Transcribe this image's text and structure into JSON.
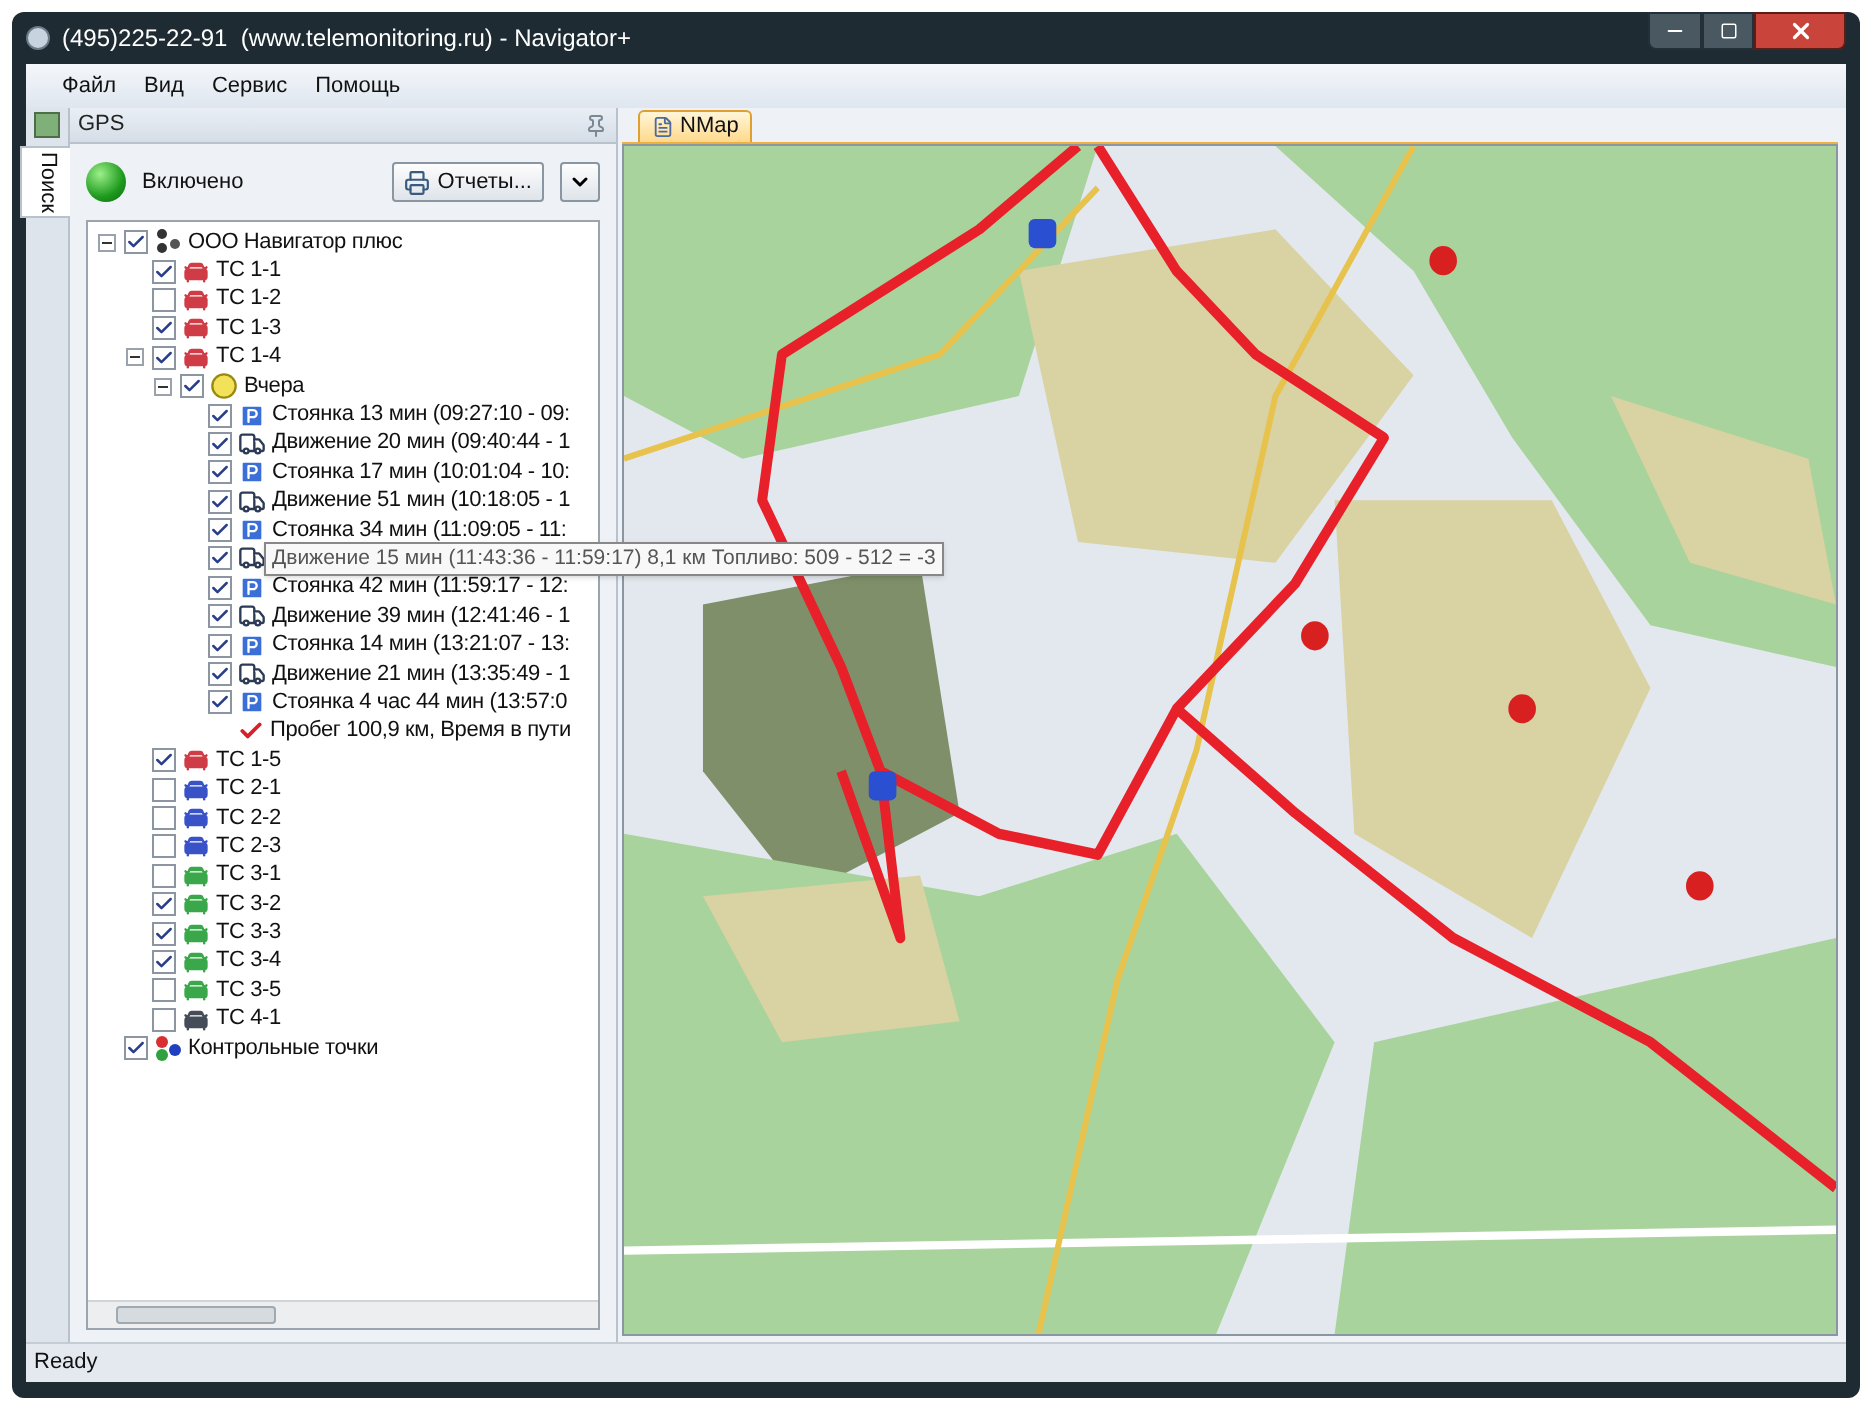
{
  "window": {
    "title": "(495)225-22-91  (www.telemonitoring.ru) - Navigator+"
  },
  "menu": [
    "Файл",
    "Вид",
    "Сервис",
    "Помощь"
  ],
  "side_tab": {
    "label": "Поиск"
  },
  "panel": {
    "title": "GPS",
    "status": {
      "label": "Включено",
      "on": true
    },
    "reports_button": "Отчеты..."
  },
  "tree": [
    {
      "kind": "company",
      "label": "ООО Навигатор плюс",
      "checked": true,
      "expanded": true,
      "children": [
        {
          "kind": "vehicle",
          "label": "ТС 1-1",
          "checked": true,
          "color": "#d03c46"
        },
        {
          "kind": "vehicle",
          "label": "ТС 1-2",
          "checked": false,
          "color": "#d03c46"
        },
        {
          "kind": "vehicle",
          "label": "ТС 1-3",
          "checked": true,
          "color": "#d03c46"
        },
        {
          "kind": "vehicle",
          "label": "ТС 1-4",
          "checked": true,
          "color": "#d03c46",
          "expanded": true,
          "children": [
            {
              "kind": "day",
              "label": "Вчера",
              "checked": true,
              "expanded": true,
              "children": [
                {
                  "kind": "parking",
                  "label": "Стоянка 13 мин (09:27:10 - 09:",
                  "checked": true
                },
                {
                  "kind": "movement",
                  "label": "Движение 20 мин (09:40:44 - 1",
                  "checked": true
                },
                {
                  "kind": "parking",
                  "label": "Стоянка 17 мин (10:01:04 - 10:",
                  "checked": true
                },
                {
                  "kind": "movement",
                  "label": "Движение 51 мин (10:18:05 - 1",
                  "checked": true
                },
                {
                  "kind": "parking",
                  "label": "Стоянка 34 мин (11:09:05 - 11:",
                  "checked": true
                },
                {
                  "kind": "movement",
                  "tooltip": "Движение 15 мин (11:43:36 - 11:59:17) 8,1 км  Топливо: 509 - 512 = -3",
                  "checked": true
                },
                {
                  "kind": "parking",
                  "label": "Стоянка 42 мин (11:59:17 - 12:",
                  "checked": true
                },
                {
                  "kind": "movement",
                  "label": "Движение 39 мин (12:41:46 - 1",
                  "checked": true
                },
                {
                  "kind": "parking",
                  "label": "Стоянка 14 мин (13:21:07 - 13:",
                  "checked": true
                },
                {
                  "kind": "movement",
                  "label": "Движение 21 мин (13:35:49 - 1",
                  "checked": true
                },
                {
                  "kind": "parking",
                  "label": "Стоянка 4 час 44 мин (13:57:0",
                  "checked": true
                },
                {
                  "kind": "summary",
                  "label": "Пробег 100,9 км, Время в пути"
                }
              ]
            }
          ]
        },
        {
          "kind": "vehicle",
          "label": "ТС 1-5",
          "checked": true,
          "color": "#d03c46"
        },
        {
          "kind": "vehicle",
          "label": "ТС 2-1",
          "checked": false,
          "color": "#3a52c8"
        },
        {
          "kind": "vehicle",
          "label": "ТС 2-2",
          "checked": false,
          "color": "#3a52c8"
        },
        {
          "kind": "vehicle",
          "label": "ТС 2-3",
          "checked": false,
          "color": "#3a52c8"
        },
        {
          "kind": "vehicle",
          "label": "ТС 3-1",
          "checked": false,
          "color": "#3aa84a"
        },
        {
          "kind": "vehicle",
          "label": "ТС 3-2",
          "checked": true,
          "color": "#3aa84a"
        },
        {
          "kind": "vehicle",
          "label": "ТС 3-3",
          "checked": true,
          "color": "#3aa84a"
        },
        {
          "kind": "vehicle",
          "label": "ТС 3-4",
          "checked": true,
          "color": "#3aa84a"
        },
        {
          "kind": "vehicle",
          "label": "ТС 3-5",
          "checked": false,
          "color": "#3aa84a"
        },
        {
          "kind": "vehicle",
          "label": "ТС 4-1",
          "checked": false,
          "color": "#454d58"
        }
      ]
    },
    {
      "kind": "checkpoints",
      "label": "Контрольные точки",
      "checked": true
    }
  ],
  "map": {
    "tab": "NMap"
  },
  "status_bar": "Ready"
}
